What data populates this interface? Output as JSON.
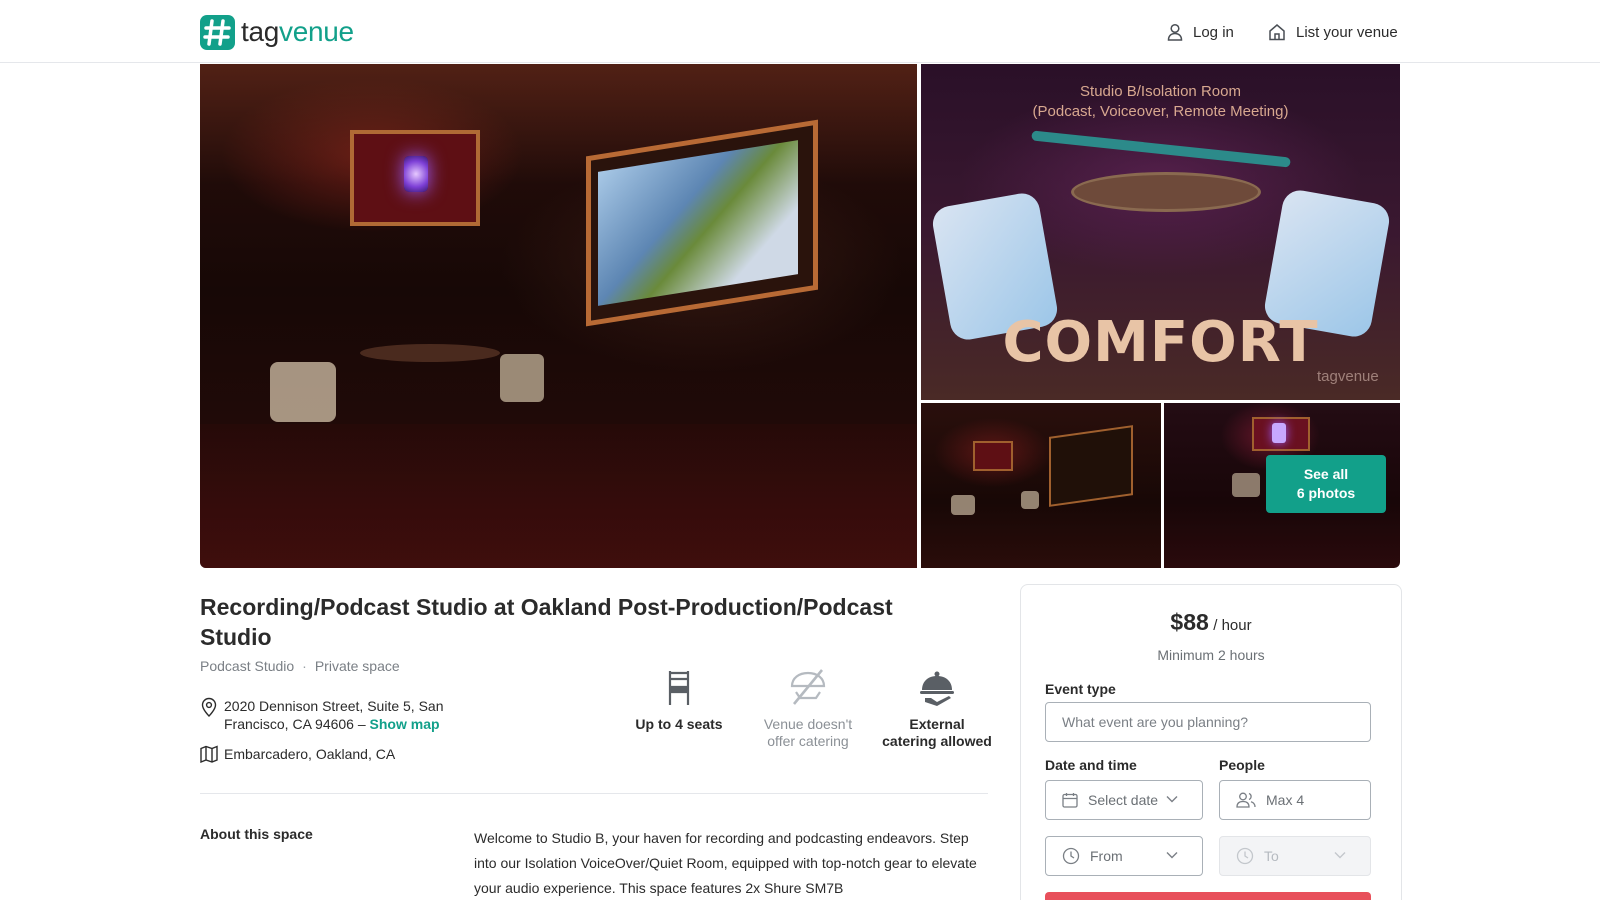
{
  "header": {
    "logo": {
      "part1": "tag",
      "part2": "venue",
      "brand_color": "#12a08a"
    },
    "nav": [
      {
        "label": "Log in",
        "icon": "user-icon"
      },
      {
        "label": "List your venue",
        "icon": "home-icon"
      }
    ]
  },
  "gallery": {
    "photo2": {
      "caption_line1": "Studio B/Isolation Room",
      "caption_line2": "(Podcast, Voiceover, Remote Meeting)",
      "overlay_text": "COMFORT",
      "watermark": "tagvenue"
    },
    "see_all_line1": "See all",
    "see_all_line2": "6 photos"
  },
  "listing": {
    "title": "Recording/Podcast Studio at Oakland Post-Production/Podcast Studio",
    "category": "Podcast Studio",
    "space_type": "Private space",
    "address": "2020 Dennison Street, Suite 5, San Francisco, CA 94606 –",
    "show_map": "Show map",
    "area": "Embarcadero, Oakland, CA",
    "features": [
      {
        "label": "Up to 4 seats",
        "icon": "chair-icon"
      },
      {
        "label": "Venue doesn't offer catering",
        "icon": "no-catering-icon"
      },
      {
        "label": "External catering allowed",
        "icon": "cloche-icon"
      }
    ],
    "about_heading": "About this space",
    "about_text": "Welcome to Studio B, your haven for recording and podcasting endeavors. Step into our Isolation VoiceOver/Quiet Room, equipped with top-notch gear to elevate your audio experience. This space features 2x Shure SM7B"
  },
  "booking": {
    "price": "$88",
    "unit": "/ hour",
    "minimum": "Minimum 2 hours",
    "event_type_label": "Event type",
    "event_type_placeholder": "What event are you planning?",
    "date_time_label": "Date and time",
    "people_label": "People",
    "date_placeholder": "Select date",
    "people_placeholder": "Max 4",
    "from_placeholder": "From",
    "to_placeholder": "To",
    "button_color": "#e8505b"
  }
}
